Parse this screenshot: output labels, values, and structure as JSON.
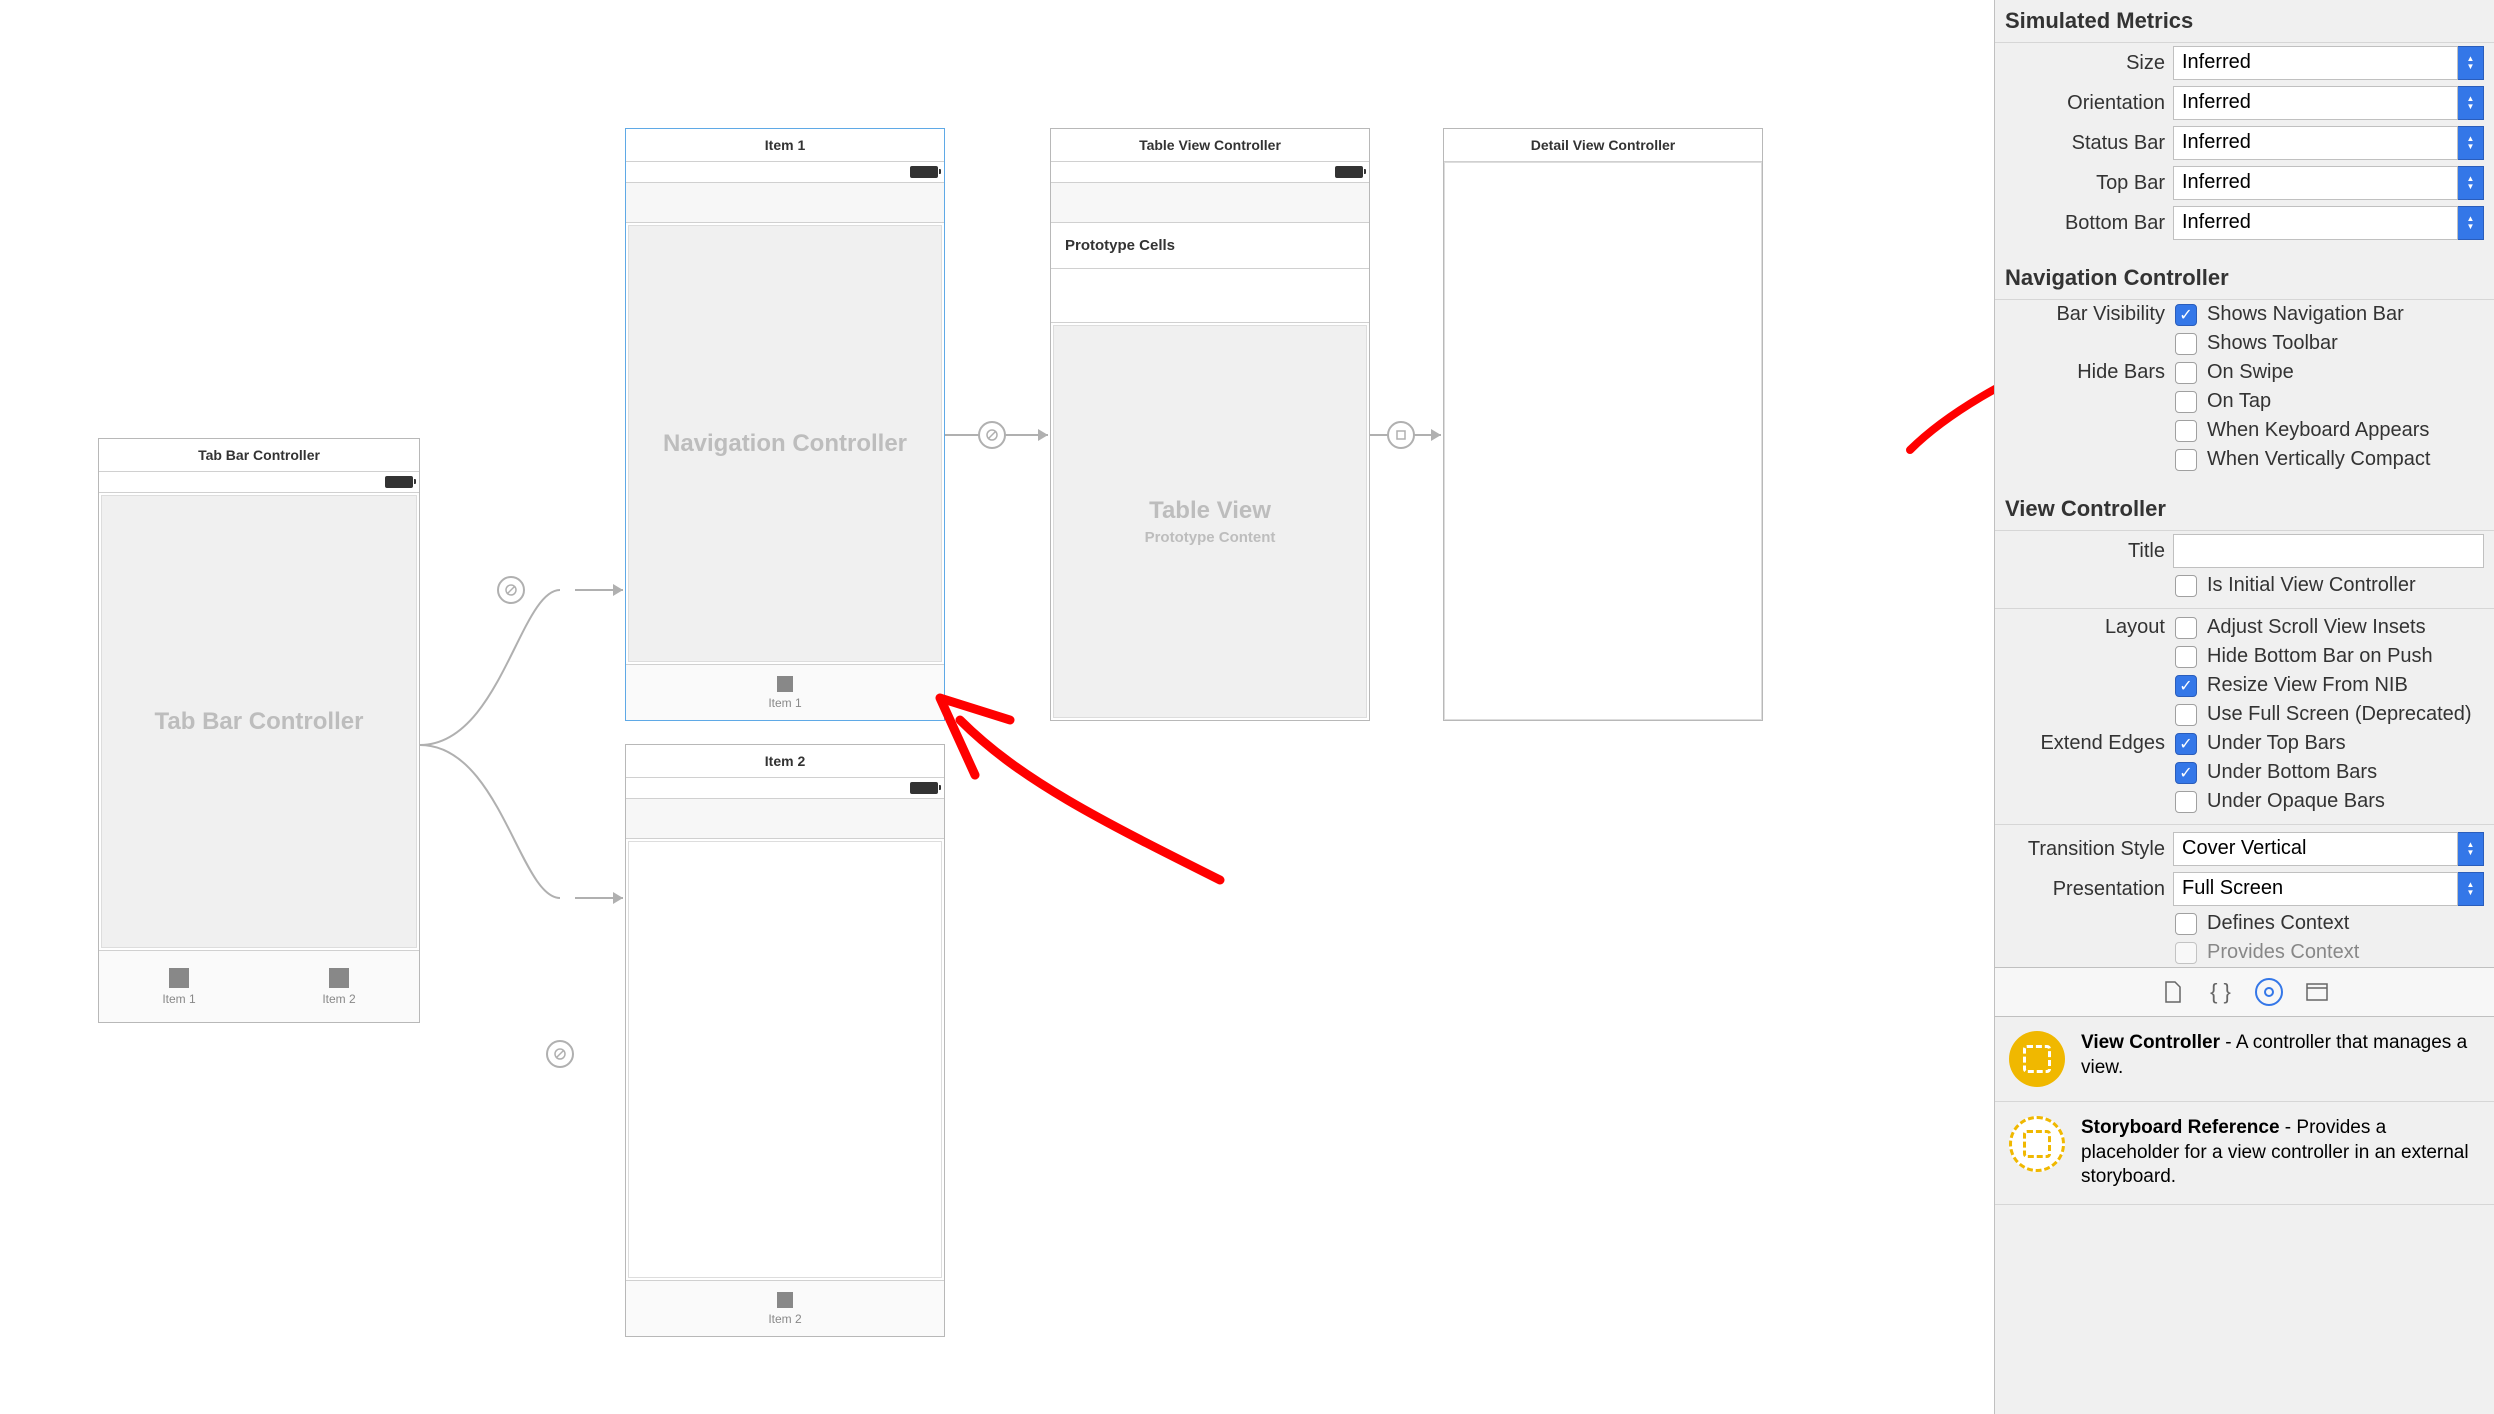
{
  "scenes": {
    "tabbar": {
      "title": "Tab Bar Controller",
      "body": "Tab Bar Controller",
      "item1": "Item 1",
      "item2": "Item 2"
    },
    "nav1": {
      "title": "Item 1",
      "body": "Navigation Controller",
      "tabItem": "Item 1"
    },
    "nav2": {
      "title": "Item 2",
      "tabItem": "Item 2"
    },
    "tableview": {
      "title": "Table View Controller",
      "proto": "Prototype Cells",
      "body": "Table View",
      "sub": "Prototype Content"
    },
    "detail": {
      "title": "Detail View Controller"
    }
  },
  "inspector": {
    "simMetrics": {
      "header": "Simulated Metrics",
      "size": {
        "label": "Size",
        "value": "Inferred"
      },
      "orientation": {
        "label": "Orientation",
        "value": "Inferred"
      },
      "statusBar": {
        "label": "Status Bar",
        "value": "Inferred"
      },
      "topBar": {
        "label": "Top Bar",
        "value": "Inferred"
      },
      "bottomBar": {
        "label": "Bottom Bar",
        "value": "Inferred"
      }
    },
    "navController": {
      "header": "Navigation Controller",
      "barVisibility": {
        "label": "Bar Visibility",
        "showsNav": "Shows Navigation Bar",
        "showsToolbar": "Shows Toolbar"
      },
      "hideBars": {
        "label": "Hide Bars",
        "onSwipe": "On Swipe",
        "onTap": "On Tap",
        "whenKeyboard": "When Keyboard Appears",
        "whenCompact": "When Vertically Compact"
      }
    },
    "viewController": {
      "header": "View Controller",
      "title": {
        "label": "Title",
        "value": ""
      },
      "isInitial": "Is Initial View Controller",
      "layout": {
        "label": "Layout",
        "adjustScroll": "Adjust Scroll View Insets",
        "hideBottom": "Hide Bottom Bar on Push",
        "resizeNib": "Resize View From NIB",
        "fullScreen": "Use Full Screen (Deprecated)"
      },
      "extendEdges": {
        "label": "Extend Edges",
        "underTop": "Under Top Bars",
        "underBottom": "Under Bottom Bars",
        "underOpaque": "Under Opaque Bars"
      },
      "transition": {
        "label": "Transition Style",
        "value": "Cover Vertical"
      },
      "presentation": {
        "label": "Presentation",
        "value": "Full Screen"
      },
      "defines": "Defines Context",
      "provides": "Provides Context"
    },
    "library": {
      "vc": {
        "title": "View Controller",
        "desc": " - A controller that manages a view."
      },
      "sr": {
        "title": "Storyboard Reference",
        "desc": " - Provides a placeholder for a view controller in an external storyboard."
      }
    }
  }
}
